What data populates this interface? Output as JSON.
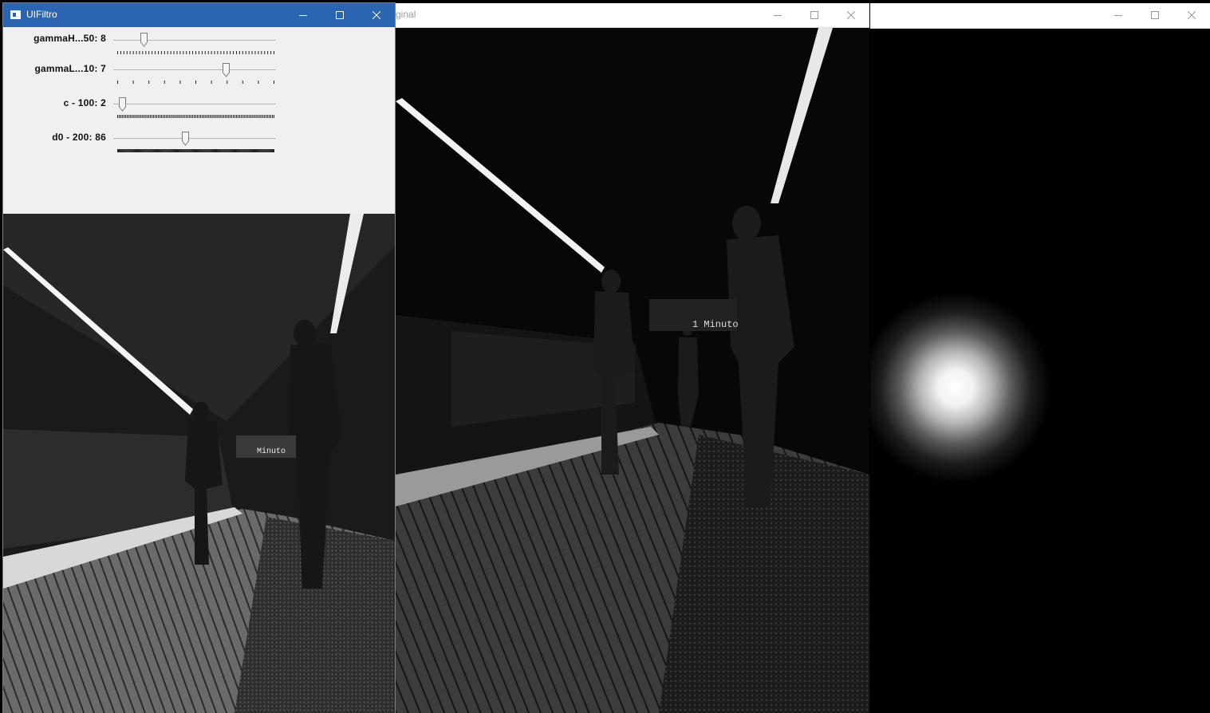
{
  "windows": {
    "ui_filtro": {
      "title": "UIFiltro",
      "trackbars": [
        {
          "label": "gammaH...50: 8",
          "value": 8,
          "max": 50
        },
        {
          "label": "gammaL...10: 7",
          "value": 7,
          "max": 10
        },
        {
          "label": "c - 100: 2",
          "value": 2,
          "max": 100
        },
        {
          "label": "d0 - 200: 86",
          "value": 86,
          "max": 200
        }
      ]
    },
    "original": {
      "title": "ginal"
    },
    "filter_window": {
      "title": ""
    }
  },
  "titlebar_buttons": [
    "minimize-icon",
    "maximize-icon",
    "close-icon"
  ],
  "colors": {
    "ui_titlebar": "#2b64b0",
    "panel_bg": "#f0f0f0",
    "filter_bg": "#000000"
  }
}
